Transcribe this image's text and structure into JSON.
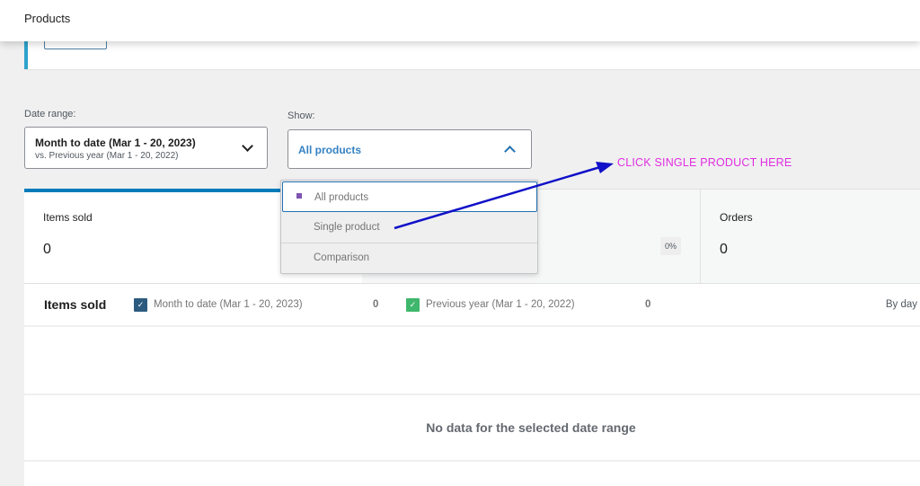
{
  "header": {
    "title": "Products"
  },
  "filters": {
    "date_range": {
      "label": "Date range:",
      "primary": "Month to date (Mar 1 - 20, 2023)",
      "secondary": "vs. Previous year (Mar 1 - 20, 2022)",
      "icon": "chevron-down-icon"
    },
    "show": {
      "label": "Show:",
      "value": "All products",
      "icon": "chevron-up-icon",
      "expanded": true,
      "options": [
        {
          "label": "All products",
          "selected": true
        },
        {
          "label": "Single product",
          "selected": false
        },
        {
          "label": "Comparison",
          "selected": false
        }
      ]
    }
  },
  "summary": {
    "cards": [
      {
        "label": "Items sold",
        "value": "0",
        "active": true
      },
      {
        "label": "",
        "value": "",
        "delta": "0%",
        "active": false
      },
      {
        "label": "Orders",
        "value": "0",
        "active": false
      }
    ]
  },
  "chart": {
    "title": "Items sold",
    "legend": [
      {
        "label": "Month to date (Mar 1 - 20, 2023)",
        "value": "0",
        "checked": true,
        "color": "#2c5b7f"
      },
      {
        "label": "Previous year (Mar 1 - 20, 2022)",
        "value": "0",
        "checked": true,
        "color": "#3fb76c"
      }
    ],
    "interval": "By day",
    "empty_message": "No data for the selected date range"
  },
  "annotation": {
    "text": "CLICK SINGLE PRODUCT HERE",
    "text_color": "#e02ee0",
    "arrow_color": "#1010c8"
  },
  "colors": {
    "accent": "#007cba",
    "notice_border": "#2ea2cc",
    "link": "#3582c4",
    "purple_dot": "#7f54b3"
  }
}
